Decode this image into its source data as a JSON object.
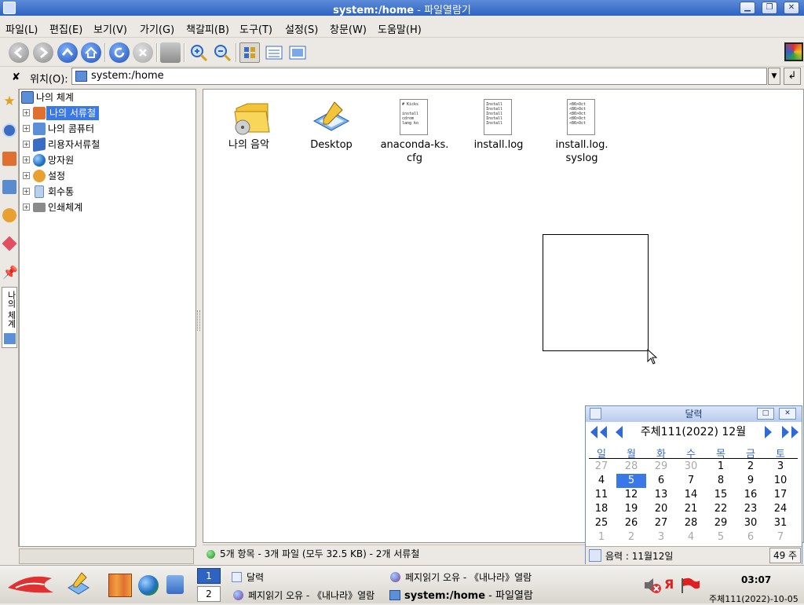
{
  "window": {
    "title": "system:/home",
    "title_suffix": " - 파일열람기"
  },
  "menubar": [
    "파일(L)",
    "편집(E)",
    "보기(V)",
    "가기(G)",
    "책갈피(B)",
    "도구(T)",
    "설정(S)",
    "창문(W)",
    "도움말(H)"
  ],
  "location": {
    "label": "위치(O):",
    "value": "system:/home"
  },
  "tree": {
    "root": "나의 체계",
    "items": [
      "나의 서류철",
      "나의 콤퓨터",
      "리용자서류철",
      "망자원",
      "설정",
      "회수통",
      "인쇄체계"
    ]
  },
  "sidestrip_label": "나의 체계",
  "files": [
    {
      "name": "나의 음악",
      "kind": "folder"
    },
    {
      "name": "Desktop",
      "kind": "desktop"
    },
    {
      "name": "anaconda-ks.\ncfg",
      "kind": "text",
      "preview": "# Kicks\n\ninstall\ncdrom\nlang ko"
    },
    {
      "name": "install.log",
      "kind": "text",
      "preview": "Install\nInstall\nInstall\nInstall\nInstall"
    },
    {
      "name": "install.log.\nsyslog",
      "kind": "text",
      "preview": "<86>Oct\n<86>Oct\n<86>Oct\n<86>Oct\n<86>Oct"
    }
  ],
  "status": "5개 항목 - 3개 파일 (모두 32.5 KB) - 2개 서류철",
  "calendar": {
    "title": "달력",
    "month_label": "주체111(2022) 12월",
    "weekdays": [
      "일",
      "월",
      "화",
      "수",
      "목",
      "금",
      "토"
    ],
    "weeks": [
      [
        "27",
        "28",
        "29",
        "30",
        "1",
        "2",
        "3"
      ],
      [
        "4",
        "5",
        "6",
        "7",
        "8",
        "9",
        "10"
      ],
      [
        "11",
        "12",
        "13",
        "14",
        "15",
        "16",
        "17"
      ],
      [
        "18",
        "19",
        "20",
        "21",
        "22",
        "23",
        "24"
      ],
      [
        "25",
        "26",
        "27",
        "28",
        "29",
        "30",
        "31"
      ],
      [
        "1",
        "2",
        "3",
        "4",
        "5",
        "6",
        "7"
      ]
    ],
    "muted_first_row": 4,
    "selected_day": "5",
    "lunar": "음력 : 11월12일",
    "week_label": "49 주"
  },
  "taskbar": {
    "desktop1": "1",
    "desktop2": "2",
    "task_calendar": "달력",
    "task_error1": "페지읽기 오유 - 《내나라》열람",
    "task_error2": "페지읽기 오유 - 《내나라》열람",
    "task_active": "system:/home",
    "task_active_suffix": " - 파일열람",
    "kb_indicator": "Я",
    "clock": "03:07",
    "date": "주체111(2022)-10-05"
  },
  "colors": {
    "accent": "#3a78e8",
    "titlebar": "#3f72cc",
    "selection": "#3a78e8"
  }
}
